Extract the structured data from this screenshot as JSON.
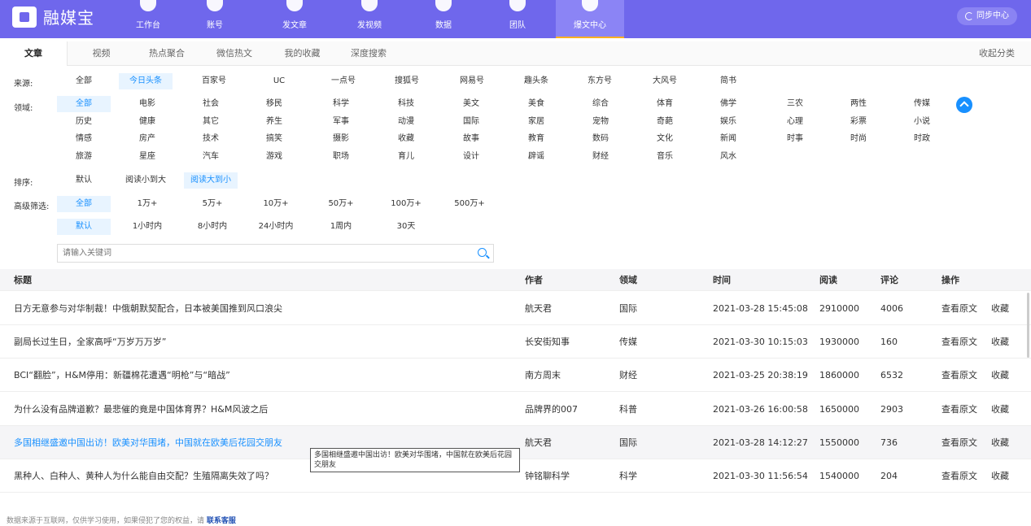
{
  "app": {
    "logo_text": "融媒宝",
    "sync_label": "同步中心"
  },
  "nav": [
    {
      "label": "工作台",
      "icon": "monitor-icon"
    },
    {
      "label": "账号",
      "icon": "user-icon"
    },
    {
      "label": "发文章",
      "icon": "pen-icon"
    },
    {
      "label": "发视频",
      "icon": "video-icon"
    },
    {
      "label": "数据",
      "icon": "data-icon"
    },
    {
      "label": "团队",
      "icon": "team-icon"
    },
    {
      "label": "爆文中心",
      "icon": "fire-icon",
      "active": true
    }
  ],
  "tabs": [
    "文章",
    "视频",
    "热点聚合",
    "微信热文",
    "我的收藏",
    "深度搜索"
  ],
  "collapse_label": "收起分类",
  "filters": {
    "source_label": "来源:",
    "sources": [
      "全部",
      "今日头条",
      "百家号",
      "UC",
      "一点号",
      "搜狐号",
      "网易号",
      "趣头条",
      "东方号",
      "大风号",
      "简书"
    ],
    "source_selected": "今日头条",
    "domain_label": "领域:",
    "domains": [
      [
        "全部",
        "电影",
        "社会",
        "移民",
        "科学",
        "科技",
        "美文",
        "美食",
        "综合",
        "体育",
        "佛学",
        "三农",
        "两性",
        "传媒"
      ],
      [
        "历史",
        "健康",
        "其它",
        "养生",
        "军事",
        "动漫",
        "国际",
        "家居",
        "宠物",
        "奇葩",
        "娱乐",
        "心理",
        "彩票",
        "小说"
      ],
      [
        "情感",
        "房产",
        "技术",
        "搞笑",
        "摄影",
        "收藏",
        "故事",
        "教育",
        "数码",
        "文化",
        "新闻",
        "时事",
        "时尚",
        "时政"
      ],
      [
        "旅游",
        "星座",
        "汽车",
        "游戏",
        "职场",
        "育儿",
        "设计",
        "辟谣",
        "财经",
        "音乐",
        "风水"
      ]
    ],
    "domain_selected": "全部",
    "sort_label": "排序:",
    "sorts": [
      "默认",
      "阅读小到大",
      "阅读大到小"
    ],
    "sort_selected": "阅读大到小",
    "advanced_label": "高级筛选:",
    "reads": [
      "全部",
      "1万+",
      "5万+",
      "10万+",
      "50万+",
      "100万+",
      "500万+"
    ],
    "read_selected": "全部",
    "times": [
      "默认",
      "1小时内",
      "8小时内",
      "24小时内",
      "1周内",
      "30天"
    ],
    "time_selected": "默认",
    "search_placeholder": "请输入关键词"
  },
  "table": {
    "headers": [
      "标题",
      "作者",
      "领域",
      "时间",
      "阅读",
      "评论",
      "操作"
    ],
    "rows": [
      {
        "title": "日方无意参与对华制裁！中俄朝默契配合，日本被美国推到风口浪尖",
        "author": "航天君",
        "domain": "国际",
        "time": "2021-03-28 15:45:08",
        "reads": "2910000",
        "comments": "4006"
      },
      {
        "title": "副局长过生日，全家高呼“万岁万万岁”",
        "author": "长安街知事",
        "domain": "传媒",
        "time": "2021-03-30 10:15:03",
        "reads": "1930000",
        "comments": "160"
      },
      {
        "title": "BCI“翻脸”，H&M停用：新疆棉花遭遇“明枪”与“暗战”",
        "author": "南方周末",
        "domain": "财经",
        "time": "2021-03-25 20:38:19",
        "reads": "1860000",
        "comments": "6532"
      },
      {
        "title": "为什么没有品牌道歉？最悲催的竟是中国体育界？H&M风波之后",
        "author": "品牌界的007",
        "domain": "科普",
        "time": "2021-03-26 16:00:58",
        "reads": "1650000",
        "comments": "2903"
      },
      {
        "title": "多国相继盛邀中国出访！欧美对华围堵，中国就在欧美后花园交朋友",
        "author": "航天君",
        "domain": "国际",
        "time": "2021-03-28 14:12:27",
        "reads": "1550000",
        "comments": "736",
        "hover": true
      },
      {
        "title": "黑种人、白种人、黄种人为什么能自由交配？生殖隔离失效了吗？",
        "author": "钟铭聊科学",
        "domain": "科学",
        "time": "2021-03-30 11:56:54",
        "reads": "1540000",
        "comments": "204"
      }
    ],
    "action_view": "查看原文",
    "action_collect": "收藏"
  },
  "tooltip": "多国相继盛邀中国出访！欧美对华围堵，中国就在欧美后花园交朋友",
  "footer": {
    "text": "数据来源于互联网，仅供学习使用，如果侵犯了您的权益，请 ",
    "link": "联系客服"
  }
}
